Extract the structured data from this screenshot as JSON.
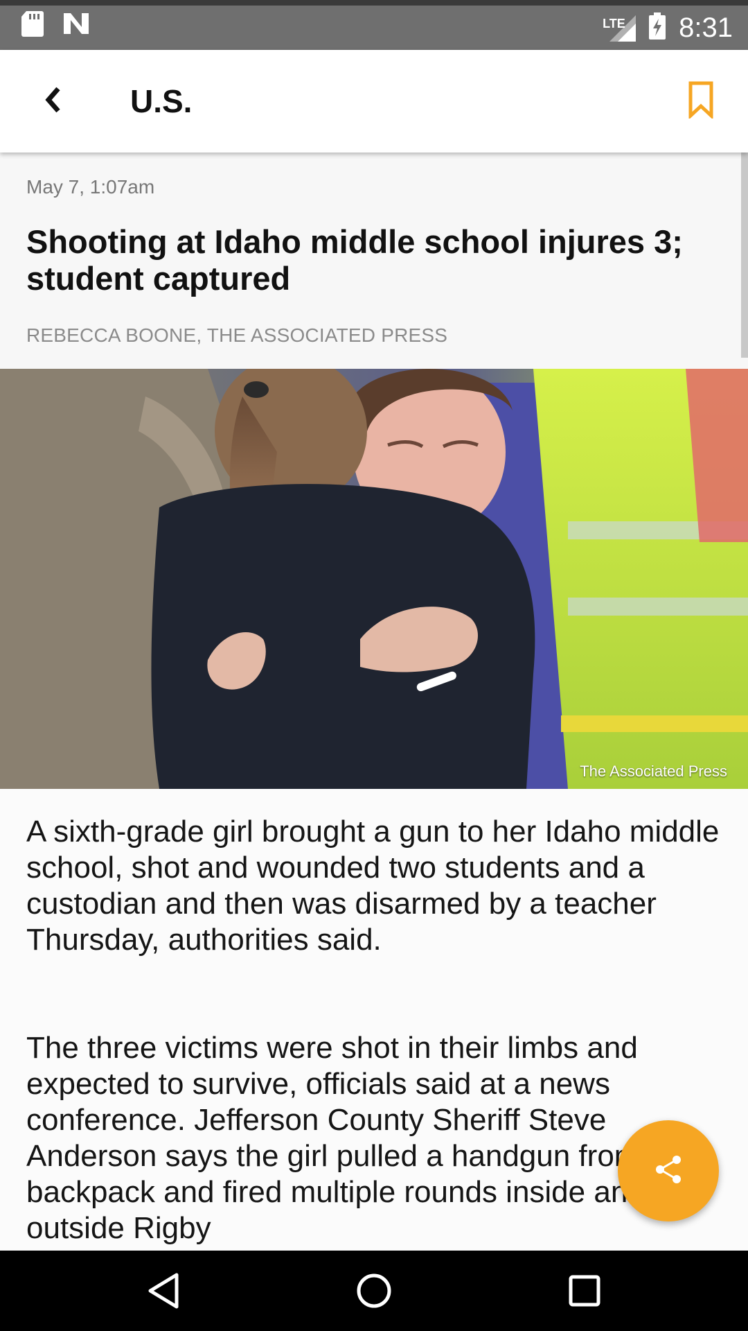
{
  "status_bar": {
    "time": "8:31",
    "network_label": "LTE",
    "icons": [
      "sd-card-icon",
      "n-notification-icon",
      "lte-signal-icon",
      "battery-charging-icon"
    ]
  },
  "app_bar": {
    "title": "U.S.",
    "back_icon": "chevron-left-icon",
    "bookmark_icon": "bookmark-icon",
    "accent_color": "#f6a623"
  },
  "article": {
    "date": "May 7, 1:07am",
    "headline": "Shooting at Idaho middle school injures 3; student captured",
    "byline": "REBECCA BOONE, THE ASSOCIATED PRESS",
    "photo_credit": "The Associated Press",
    "paragraphs": [
      "A sixth-grade girl brought a gun to her Idaho middle school, shot and wounded two students and a custodian and then was disarmed by a teacher Thursday, authorities said.",
      "The three victims were shot in their limbs and expected to survive, officials said at a news conference. Jefferson County Sheriff Steve Anderson says the girl pulled a handgun from her backpack and fired multiple rounds inside and outside Rigby"
    ]
  },
  "fab": {
    "icon": "share-icon",
    "color": "#f6a623"
  },
  "nav_bar": {
    "icons": [
      "nav-back-icon",
      "nav-home-icon",
      "nav-recents-icon"
    ]
  }
}
